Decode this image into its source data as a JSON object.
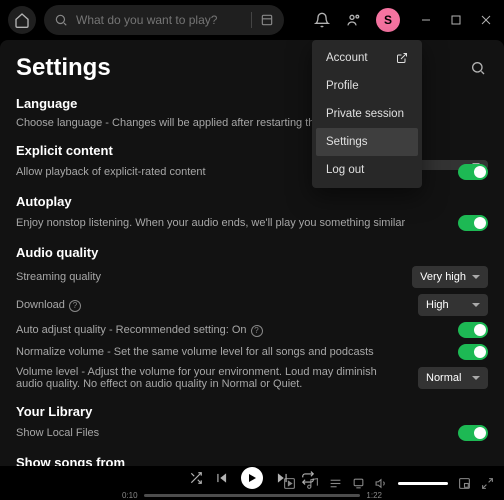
{
  "topbar": {
    "search_placeholder": "What do you want to play?",
    "avatar_letter": "S"
  },
  "menu": {
    "items": [
      {
        "label": "Account",
        "external": true
      },
      {
        "label": "Profile"
      },
      {
        "label": "Private session"
      },
      {
        "label": "Settings",
        "active": true
      },
      {
        "label": "Log out"
      }
    ]
  },
  "settings": {
    "title": "Settings",
    "language": {
      "heading": "Language",
      "desc": "Choose language - Changes will be applied after restarting the app"
    },
    "explicit": {
      "heading": "Explicit content",
      "desc": "Allow playback of explicit-rated content"
    },
    "autoplay": {
      "heading": "Autoplay",
      "desc": "Enjoy nonstop listening. When your audio ends, we'll play you something similar"
    },
    "audio": {
      "heading": "Audio quality",
      "streaming_label": "Streaming quality",
      "streaming_value": "Very high",
      "download_label": "Download",
      "download_value": "High",
      "auto_adjust": "Auto adjust quality - Recommended setting: On",
      "normalize": "Normalize volume - Set the same volume level for all songs and podcasts",
      "volume_level_label": "Volume level - Adjust the volume for your environment. Loud may diminish audio quality. No effect on audio quality in Normal or Quiet.",
      "volume_level_value": "Normal"
    },
    "library": {
      "heading": "Your Library",
      "show_local": "Show Local Files"
    },
    "show_songs": {
      "heading": "Show songs from"
    }
  },
  "player": {
    "current": "0:10",
    "duration": "1:22"
  }
}
